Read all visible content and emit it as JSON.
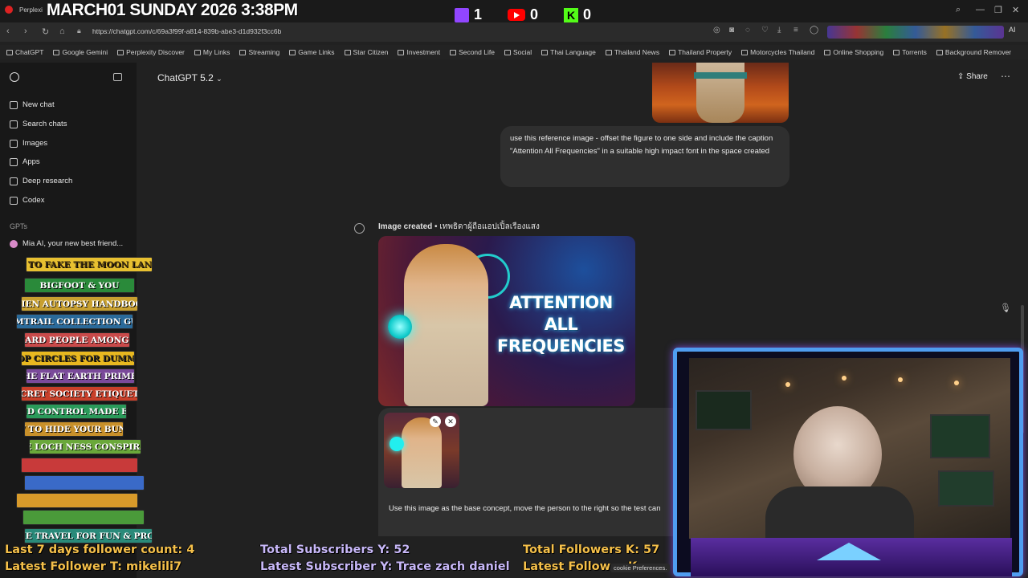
{
  "stream": {
    "date_text": "MARCH01 SUNDAY 2026 3:38PM",
    "twitch_count": "1",
    "youtube_count": "0",
    "kick_count": "0",
    "stats": {
      "followers_7days": "Last 7 days follower count: 4",
      "latest_follower_t": "Latest Follower T: mikelili7",
      "total_subs_y": "Total Subscribers Y: 52",
      "latest_sub_y": "Latest Subscriber Y: Trace zach daniel",
      "total_followers_k": "Total Followers K: 57",
      "latest_follower_k": "Latest Follower K:"
    },
    "books": [
      "HOW TO FAKE THE MOON LANDING",
      "BIGFOOT & YOU",
      "ALIEN AUTOPSY HANDBOOK",
      "CHEMTRAIL COLLECTION GUIDE",
      "LIZARD PEOPLE AMONG US",
      "CROP CIRCLES FOR DUMMIES",
      "THE FLAT EARTH PRIMER",
      "SECRET SOCIETY ETIQUETTE",
      "MIND CONTROL MADE EASY",
      "HOW TO HIDE YOUR BUNKER",
      "THE LOCH NESS CONSPIRACY",
      "TIME TRAVEL FOR FUN & PROFIT"
    ]
  },
  "browser": {
    "tab_label": "Perplexi",
    "url": "https://chatgpt.com/c/69a3f99f-a814-839b-abe3-d1d932f3cc6b",
    "bookmarks": [
      "ChatGPT",
      "Google Gemini",
      "Perplexity Discover",
      "My Links",
      "Streaming",
      "Game Links",
      "Star Citizen",
      "Investment",
      "Second Life",
      "Social",
      "Thai Language",
      "Thailand News",
      "Thailand Property",
      "Motorcycles Thailand",
      "Online Shopping",
      "Torrents",
      "Background Remover"
    ]
  },
  "sidebar": {
    "items": [
      {
        "label": "New chat",
        "icon": "new-chat-icon"
      },
      {
        "label": "Search chats",
        "icon": "search-icon"
      },
      {
        "label": "Images",
        "icon": "image-icon"
      },
      {
        "label": "Apps",
        "icon": "apps-icon"
      },
      {
        "label": "Deep research",
        "icon": "research-icon"
      },
      {
        "label": "Codex",
        "icon": "codex-icon"
      }
    ],
    "gpts_label": "GPTs",
    "gpt_item": "Mia AI, your new best friend..."
  },
  "chat": {
    "model": "ChatGPT 5.2",
    "share": "Share",
    "user_message": "use this reference image - offset the figure to one side and include the caption \"Attention All Frequencies\" in a suitable high impact font in the space created",
    "image_created_label": "Image created",
    "image_created_title": "• เทพธิดาผู้ถือแอปเปิ้ลเรืองแสง",
    "image_caption": "ATTENTION ALL FREQUENCIES",
    "composer_text": "Use this image as the base concept, move the person to the right so the test can",
    "cookie_text": "cookie Preferences."
  }
}
